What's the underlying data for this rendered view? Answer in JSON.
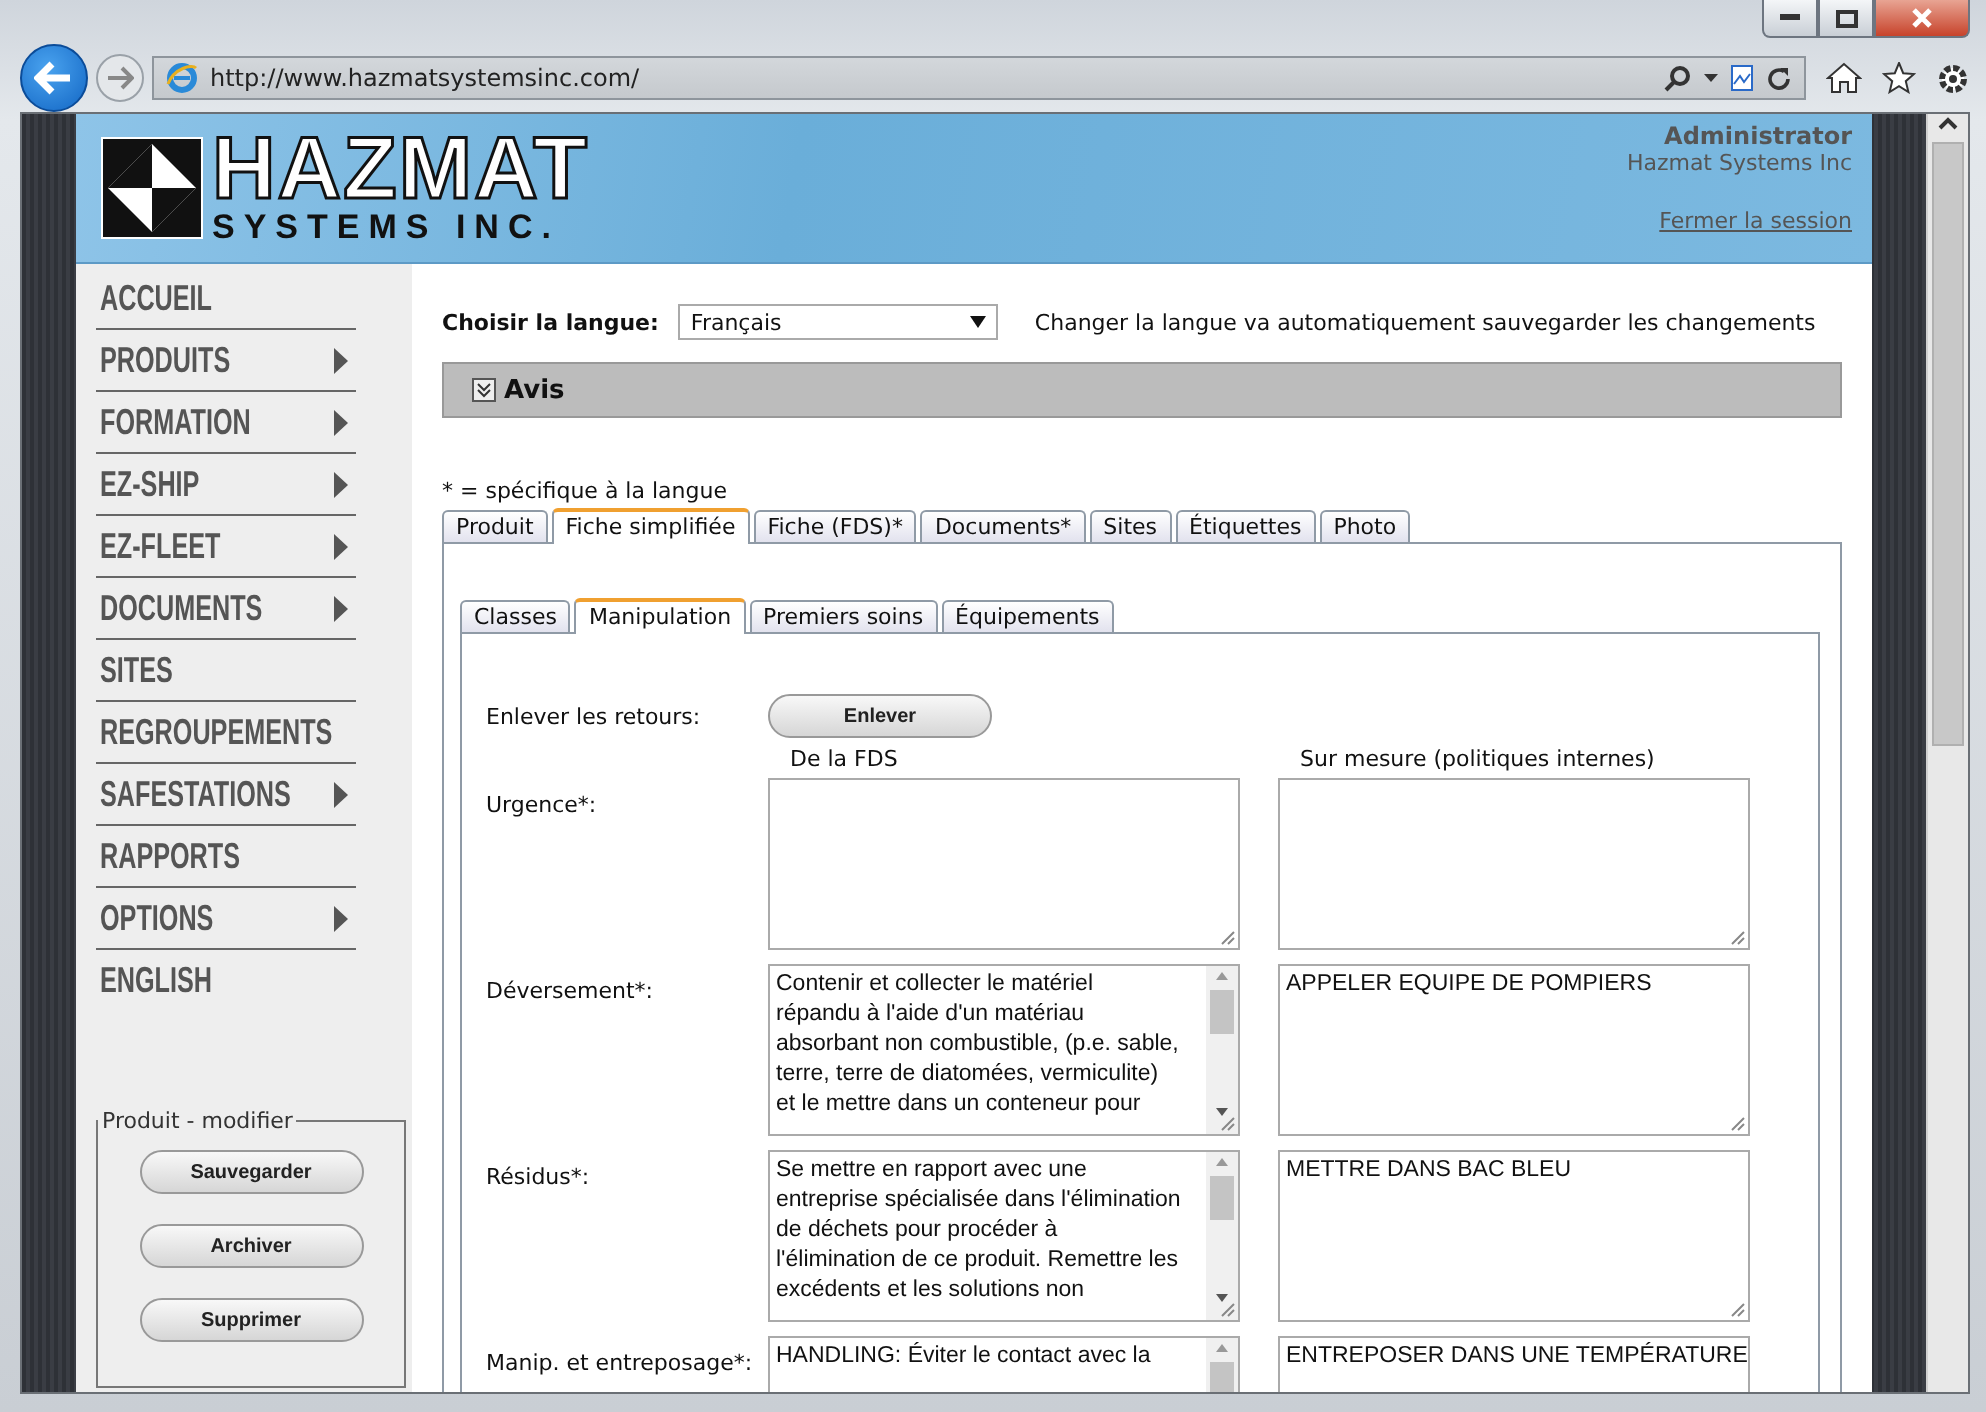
{
  "browser": {
    "url": "http://www.hazmatsystemsinc.com/"
  },
  "header": {
    "logo_title": "HAZMAT",
    "logo_subtitle": "SYSTEMS INC.",
    "user": "Administrator",
    "company": "Hazmat Systems Inc",
    "logout": "Fermer la session"
  },
  "sidebar": {
    "items": [
      {
        "label": "ACCUEIL",
        "submenu": false
      },
      {
        "label": "PRODUITS",
        "submenu": true
      },
      {
        "label": "FORMATION",
        "submenu": true
      },
      {
        "label": "EZ-SHIP",
        "submenu": true
      },
      {
        "label": "EZ-FLEET",
        "submenu": true
      },
      {
        "label": "DOCUMENTS",
        "submenu": true
      },
      {
        "label": "SITES",
        "submenu": false
      },
      {
        "label": "REGROUPEMENTS",
        "submenu": false
      },
      {
        "label": "SAFESTATIONS",
        "submenu": true
      },
      {
        "label": "RAPPORTS",
        "submenu": false
      },
      {
        "label": "OPTIONS",
        "submenu": true
      },
      {
        "label": "ENGLISH",
        "submenu": false
      }
    ],
    "panel": {
      "title": "Produit - modifier",
      "buttons": [
        "Sauvegarder",
        "Archiver",
        "Supprimer"
      ]
    }
  },
  "language": {
    "label": "Choisir la langue:",
    "value": "Français",
    "note": "Changer la langue va automatiquement sauvegarder les changements"
  },
  "notice": {
    "title": "Avis",
    "expanded": false
  },
  "legend": "* = spécifique à la langue",
  "tabs": [
    {
      "label": "Produit",
      "selected": false
    },
    {
      "label": "Fiche simplifiée",
      "selected": true
    },
    {
      "label": "Fiche (FDS)*",
      "selected": false
    },
    {
      "label": "Documents*",
      "selected": false
    },
    {
      "label": "Sites",
      "selected": false
    },
    {
      "label": "Étiquettes",
      "selected": false
    },
    {
      "label": "Photo",
      "selected": false
    }
  ],
  "subtabs": [
    {
      "label": "Classes",
      "selected": false
    },
    {
      "label": "Manipulation",
      "selected": true
    },
    {
      "label": "Premiers soins",
      "selected": false
    },
    {
      "label": "Équipements",
      "selected": false
    }
  ],
  "remove_returns": {
    "label": "Enlever les retours:",
    "button": "Enlever"
  },
  "columns": [
    "De la FDS",
    "Sur mesure (politiques internes)"
  ],
  "fields": [
    {
      "label": "Urgence*:",
      "fds_scrollable": false
    },
    {
      "label": "Déversement*:",
      "fds": [
        "Contenir et collecter le matériel",
        "répandu à l'aide d'un matériau",
        "absorbant non combustible, (p.e. sable,",
        "terre, terre de diatomées, vermiculite)",
        "et le mettre dans un conteneur pour"
      ],
      "fds_scrollable": true,
      "custom": "APPELER EQUIPE DE POMPIERS"
    },
    {
      "label": "Résidus*:",
      "fds": [
        "Se mettre en rapport avec une",
        "entreprise spécialisée dans l'élimination",
        "de déchets pour procéder à",
        "l'élimination de ce produit. Remettre les",
        "excédents et les solutions non"
      ],
      "fds_scrollable": true,
      "custom": "METTRE DANS BAC BLEU"
    },
    {
      "label": "Manip. et entreposage*:",
      "fds": [
        "HANDLING: Éviter le contact avec la"
      ],
      "fds_scrollable": true,
      "custom": "ENTREPOSER DANS UNE TEMPÉRATURE"
    }
  ]
}
